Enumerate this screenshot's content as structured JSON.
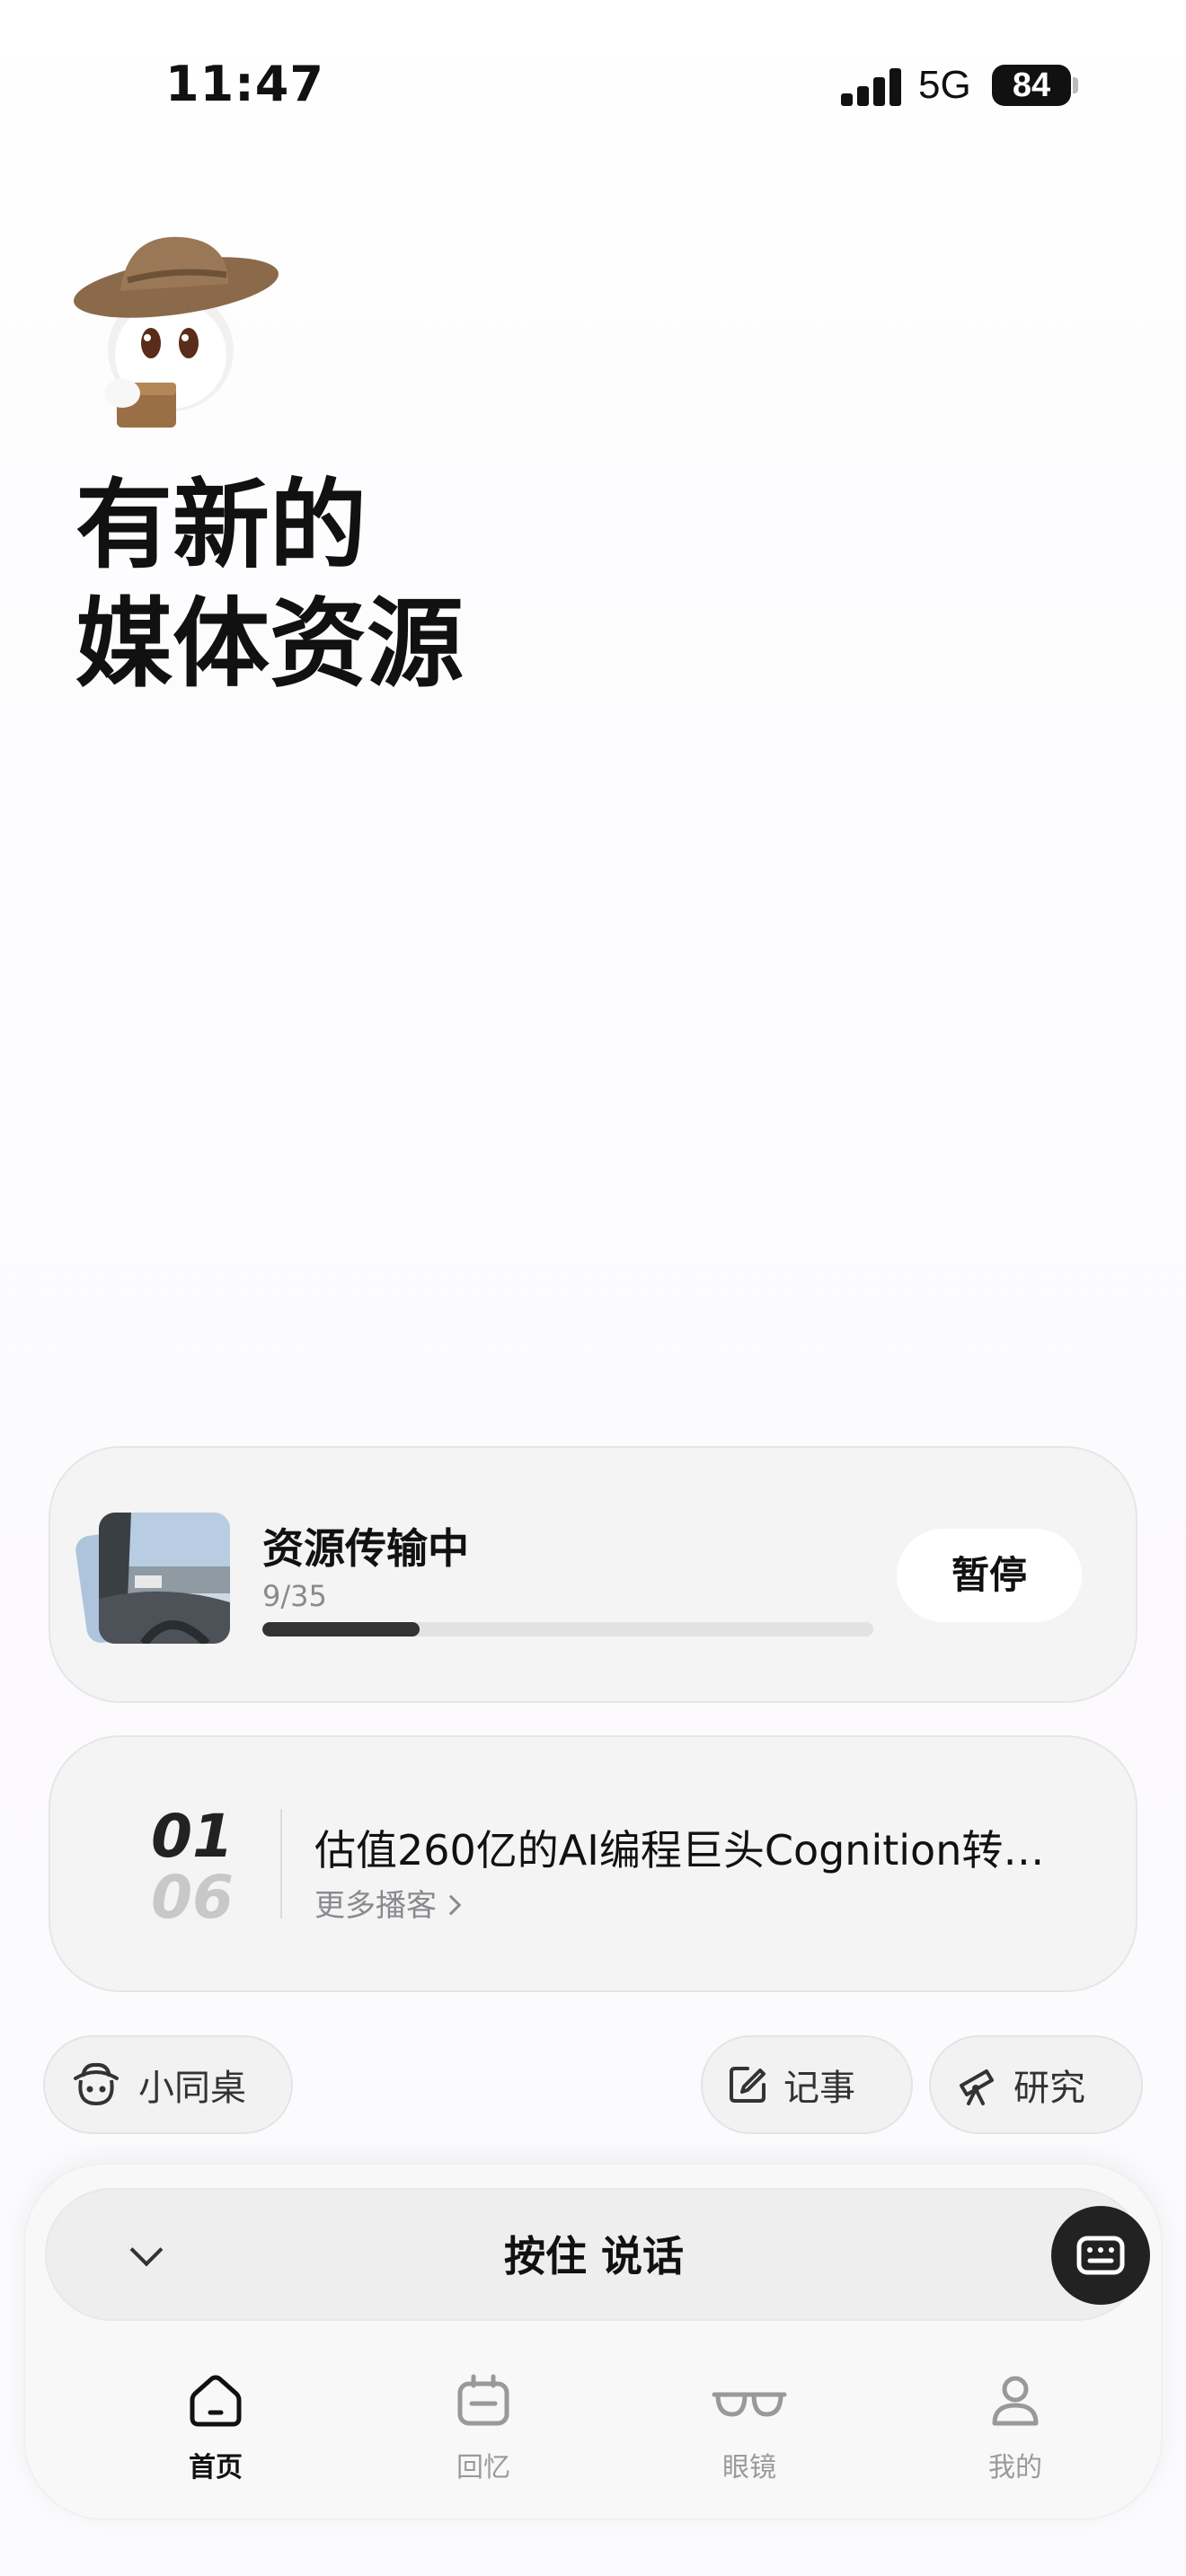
{
  "status_bar": {
    "time": "11:47",
    "network": "5G",
    "battery": "84"
  },
  "mascot": {
    "icon": "cowboy-mascot-icon"
  },
  "headline": {
    "line1": "有新的",
    "line2": "媒体资源"
  },
  "transfer": {
    "title": "资源传输中",
    "count": "9/35",
    "progress": 0.257,
    "pause_label": "暂停"
  },
  "podcast": {
    "index_current": "01",
    "index_total": "06",
    "title": "估值260亿的AI编程巨头Cognition转…",
    "more_label": "更多播客"
  },
  "chips": {
    "desk": "小同桌",
    "note": "记事",
    "research": "研究"
  },
  "voice": {
    "label": "按住 说话"
  },
  "tabs": [
    {
      "label": "首页",
      "icon": "home-icon",
      "active": true
    },
    {
      "label": "回忆",
      "icon": "memory-icon",
      "active": false
    },
    {
      "label": "眼镜",
      "icon": "glasses-icon",
      "active": false
    },
    {
      "label": "我的",
      "icon": "profile-icon",
      "active": false
    }
  ],
  "colors": {
    "text": "#111111",
    "muted": "#8a8a8e",
    "card": "#f4f4f5",
    "progress": "#333333"
  }
}
